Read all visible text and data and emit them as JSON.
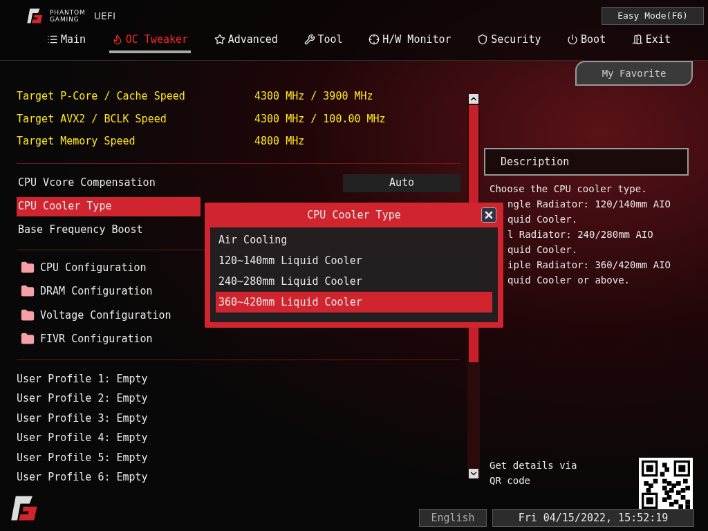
{
  "brand": {
    "line1": "PHANTOM",
    "line2": "GAMING",
    "product": "UEFI"
  },
  "easy_mode_button": "Easy Mode(F6)",
  "tabs": [
    {
      "label": "Main",
      "selected": false
    },
    {
      "label": "OC Tweaker",
      "selected": true
    },
    {
      "label": "Advanced",
      "selected": false
    },
    {
      "label": "Tool",
      "selected": false
    },
    {
      "label": "H/W Monitor",
      "selected": false
    },
    {
      "label": "Security",
      "selected": false
    },
    {
      "label": "Boot",
      "selected": false
    },
    {
      "label": "Exit",
      "selected": false
    }
  ],
  "my_favorite_button": "My Favorite",
  "targets": [
    {
      "label": "Target P-Core / Cache Speed",
      "value": "4300 MHz / 3900 MHz"
    },
    {
      "label": "Target AVX2 / BCLK Speed",
      "value": "4300 MHz / 100.00 MHz"
    },
    {
      "label": "Target Memory Speed",
      "value": "4800 MHz"
    }
  ],
  "settings": [
    {
      "label": "CPU Vcore Compensation",
      "value": "Auto",
      "selected": false
    },
    {
      "label": "CPU Cooler Type",
      "selected": true
    },
    {
      "label": "Base Frequency Boost",
      "selected": false
    }
  ],
  "submenus": [
    "CPU Configuration",
    "DRAM Configuration",
    "Voltage Configuration",
    "FIVR Configuration"
  ],
  "profiles": [
    "User Profile 1: Empty",
    "User Profile 2: Empty",
    "User Profile 3: Empty",
    "User Profile 4: Empty",
    "User Profile 5: Empty",
    "User Profile 6: Empty"
  ],
  "description": {
    "title": "Description",
    "lines": [
      "Choose the CPU cooler type.",
      "ngle Radiator: 120/140mm AIO",
      "quid Cooler.",
      "l Radiator: 240/280mm AIO",
      "quid Cooler.",
      "iple Radiator: 360/420mm AIO",
      "quid Cooler or above."
    ]
  },
  "qr_text": "Get details via QR code",
  "dialog": {
    "title": "CPU Cooler Type",
    "options": [
      {
        "label": "Air Cooling",
        "selected": false
      },
      {
        "label": "120~140mm Liquid Cooler",
        "selected": false
      },
      {
        "label": "240~280mm Liquid Cooler",
        "selected": false
      },
      {
        "label": "360~420mm Liquid Cooler",
        "selected": true
      }
    ]
  },
  "language_button": "English",
  "datetime": "Fri 04/15/2022, 15:52:19"
}
